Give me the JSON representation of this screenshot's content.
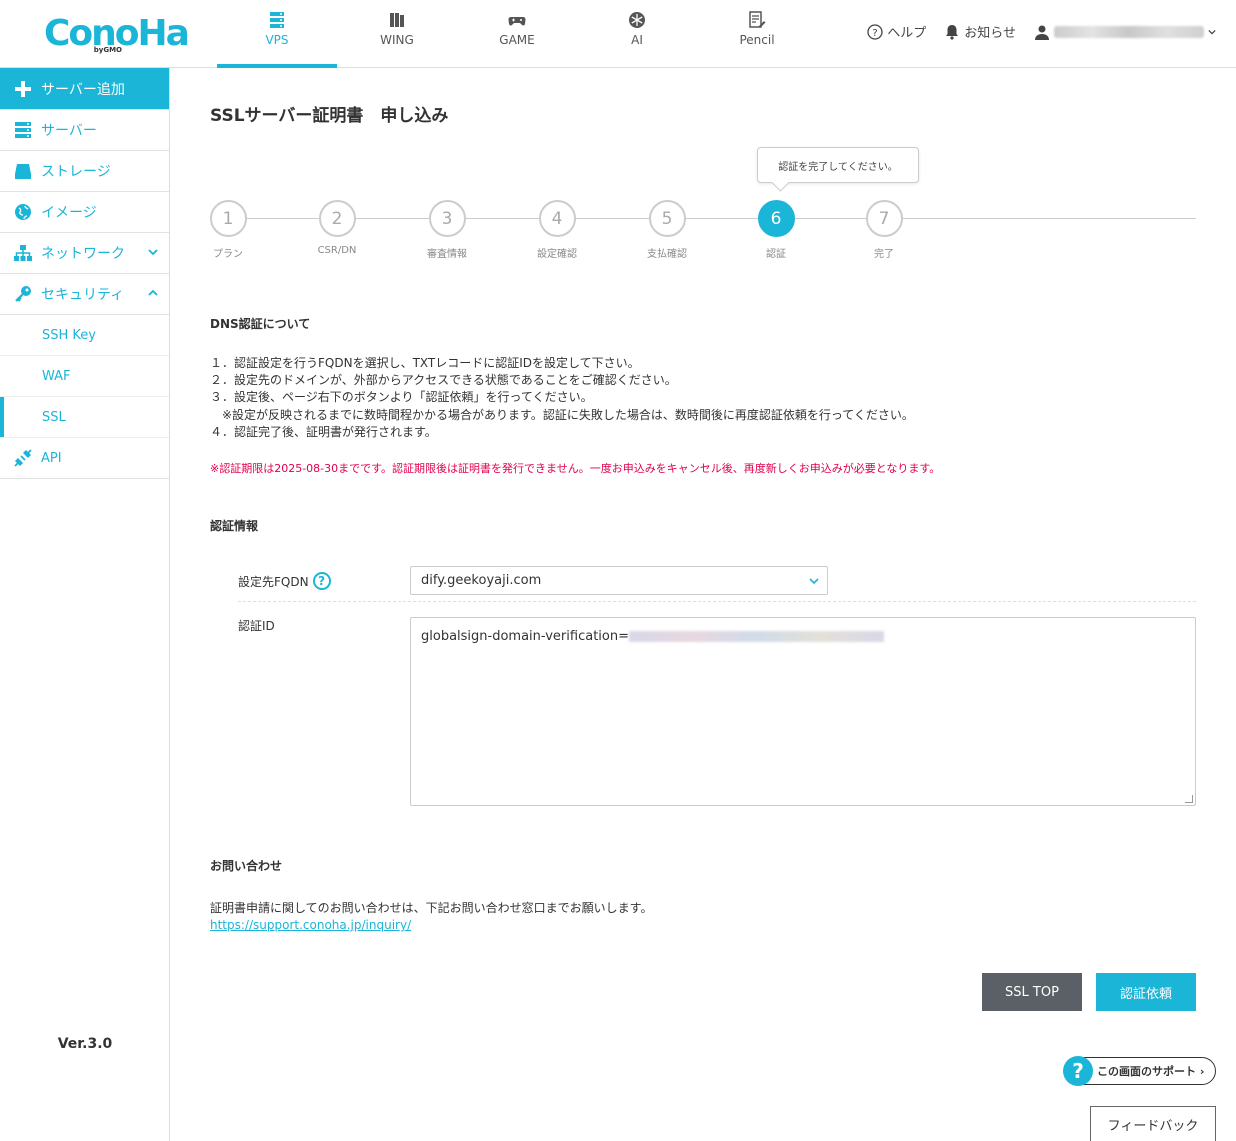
{
  "brand": {
    "logo_text": "ConoHa",
    "logo_by": "byGMO",
    "color": "#1bb5d8"
  },
  "nav": [
    {
      "label": "VPS",
      "icon": "server-icon",
      "active": true
    },
    {
      "label": "WING",
      "icon": "wing-icon"
    },
    {
      "label": "GAME",
      "icon": "gamepad-icon"
    },
    {
      "label": "AI",
      "icon": "ai-icon"
    },
    {
      "label": "Pencil",
      "icon": "pencil-icon"
    }
  ],
  "header": {
    "help": "ヘルプ",
    "notice": "お知らせ"
  },
  "sidebar": {
    "add_server": "サーバー追加",
    "items": [
      {
        "label": "サーバー",
        "icon": "server-icon"
      },
      {
        "label": "ストレージ",
        "icon": "storage-icon"
      },
      {
        "label": "イメージ",
        "icon": "image-icon"
      },
      {
        "label": "ネットワーク",
        "icon": "network-icon"
      },
      {
        "label": "セキュリティ",
        "icon": "key-icon"
      }
    ],
    "security_sub": [
      "SSH Key",
      "WAF",
      "SSL"
    ],
    "api": "API",
    "version": "Ver.3.0"
  },
  "page": {
    "title": "SSLサーバー証明書　申し込み"
  },
  "tooltip": "認証を完了してください。",
  "steps": [
    {
      "num": "1",
      "label": "プラン"
    },
    {
      "num": "2",
      "label": "CSR/DN"
    },
    {
      "num": "3",
      "label": "審査情報"
    },
    {
      "num": "4",
      "label": "設定確認"
    },
    {
      "num": "5",
      "label": "支払確認"
    },
    {
      "num": "6",
      "label": "認証",
      "active": true
    },
    {
      "num": "7",
      "label": "完了"
    }
  ],
  "dns": {
    "title": "DNS認証について",
    "lines": [
      "１．認証設定を行うFQDNを選択し、TXTレコードに認証IDを設定して下さい。",
      "２．設定先のドメインが、外部からアクセスできる状態であることをご確認ください。",
      "３．設定後、ページ右下のボタンより「認証依頼」を行ってください。",
      "　※設定が反映されるまでに数時間程かかる場合があります。認証に失敗した場合は、数時間後に再度認証依頼を行ってください。",
      "４．認証完了後、証明書が発行されます。"
    ],
    "warning": "※認証期限は2025-08-30までです。認証期限後は証明書を発行できません。一度お申込みをキャンセル後、再度新しくお申込みが必要となります。"
  },
  "auth": {
    "title": "認証情報",
    "fqdn_label": "設定先FQDN",
    "fqdn_value": "dify.geekoyaji.com",
    "id_label": "認証ID",
    "id_prefix": "globalsign-domain-verification="
  },
  "contact": {
    "title": "お問い合わせ",
    "text": "証明書申請に関してのお問い合わせは、下記お問い合わせ窓口までお願いします。",
    "link": "https://support.conoha.jp/inquiry/"
  },
  "buttons": {
    "ssl_top": "SSL TOP",
    "request": "認証依頼"
  },
  "support": {
    "q": "?",
    "label": "この画面のサポート ›"
  },
  "feedback": "フィードバック"
}
